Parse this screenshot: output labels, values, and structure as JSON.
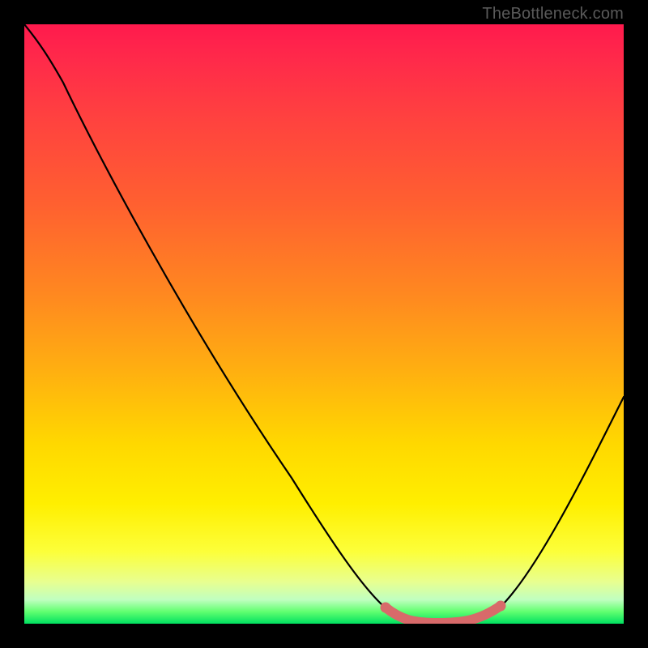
{
  "watermark": "TheBottleneck.com",
  "chart_data": {
    "type": "line",
    "title": "",
    "xlabel": "",
    "ylabel": "",
    "xlim": [
      0,
      100
    ],
    "ylim": [
      0,
      100
    ],
    "grid": false,
    "legend": false,
    "background_gradient": {
      "top_color": "#ff1a4d",
      "bottom_color": "#00e060",
      "description": "red-orange-yellow-green vertical gradient (bottleneck severity scale)"
    },
    "series": [
      {
        "name": "bottleneck-curve",
        "color": "#000000",
        "x": [
          0,
          3,
          6,
          10,
          15,
          20,
          30,
          40,
          50,
          56,
          60,
          64,
          68,
          72,
          76,
          80,
          86,
          92,
          100
        ],
        "y": [
          100,
          98,
          94,
          90,
          83,
          76,
          62,
          47,
          31,
          16,
          6,
          1,
          0,
          0,
          0,
          1,
          6,
          16,
          38
        ]
      },
      {
        "name": "minimum-band-marker",
        "color": "#d86a6a",
        "x": [
          60,
          63,
          66,
          70,
          74,
          78,
          80
        ],
        "y": [
          3.2,
          1.2,
          0.4,
          0,
          0,
          0.4,
          3.2
        ]
      }
    ],
    "annotations": [
      {
        "name": "optimal-region",
        "x_range": [
          60,
          80
        ],
        "description": "pink rounded segment along the curve bottom marking the low-bottleneck plateau"
      }
    ]
  }
}
